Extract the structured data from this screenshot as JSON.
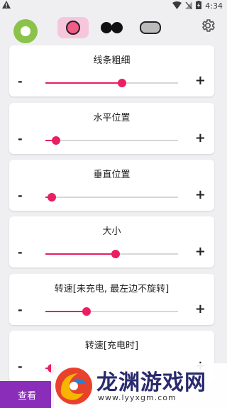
{
  "status": {
    "time": "4:34"
  },
  "toolbar": {
    "shapes": [
      "circle",
      "dual",
      "pill"
    ]
  },
  "cards": [
    {
      "title": "线条粗细",
      "minus": "-",
      "plus": "+",
      "value": 0.58
    },
    {
      "title": "水平位置",
      "minus": "-",
      "plus": "+",
      "value": 0.08
    },
    {
      "title": "垂直位置",
      "minus": "-",
      "plus": "+",
      "value": 0.05
    },
    {
      "title": "大小",
      "minus": "-",
      "plus": "+",
      "value": 0.53
    },
    {
      "title": "转速[未充电, 最左边不旋转]",
      "minus": "-",
      "plus": "+",
      "value": 0.31
    },
    {
      "title": "转速[充电时]",
      "minus": "-",
      "plus": "+",
      "value": 0.05
    }
  ],
  "bottom": {
    "view_label": "查看"
  },
  "watermark": {
    "title": "龙渊游戏网",
    "url": "www.lyyxgm.com"
  },
  "colors": {
    "accent": "#e91e63",
    "green": "#8bc34a",
    "purple": "#8a2db8"
  }
}
